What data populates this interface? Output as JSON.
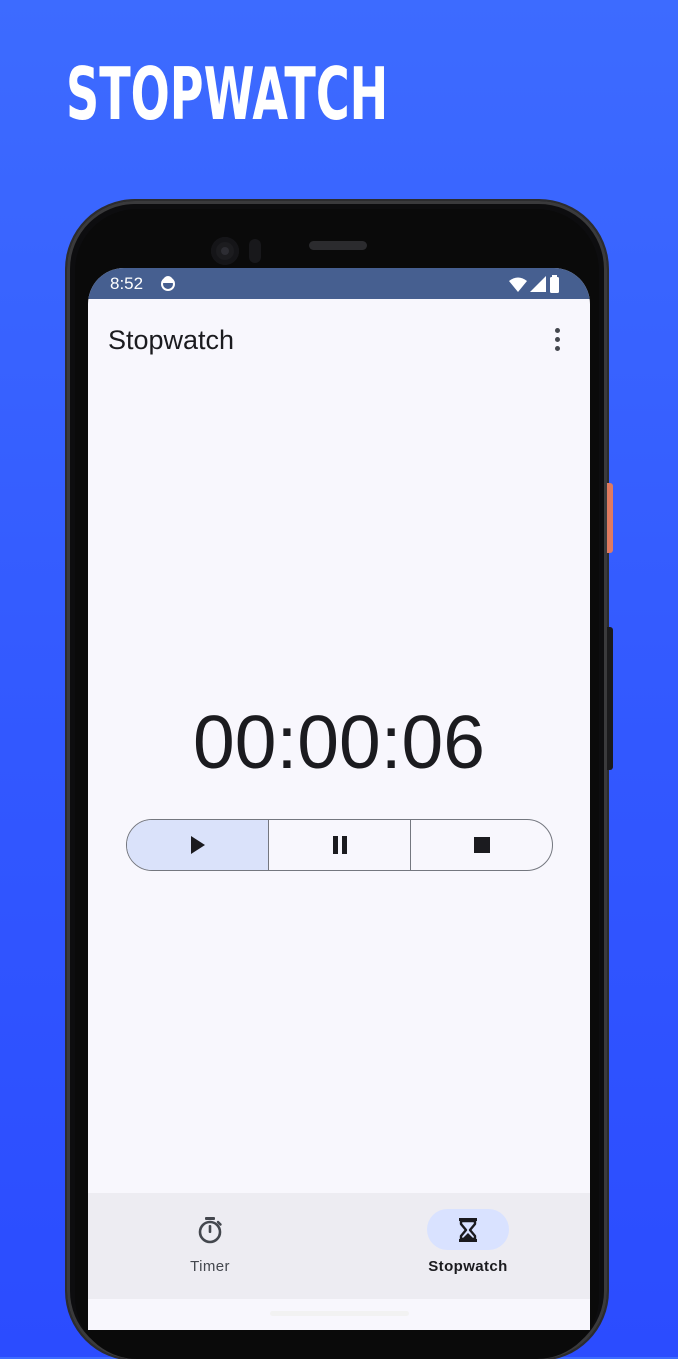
{
  "promo": {
    "title": "STOPWATCH"
  },
  "status_bar": {
    "time": "8:52",
    "icons": [
      "sync-icon",
      "wifi-icon",
      "cellular-signal-icon",
      "battery-icon"
    ]
  },
  "app_bar": {
    "title": "Stopwatch",
    "overflow_icon": "more-vert-icon"
  },
  "stopwatch": {
    "elapsed": "00:00:06"
  },
  "controls": [
    {
      "name": "start",
      "icon": "play-icon",
      "selected": true
    },
    {
      "name": "pause",
      "icon": "pause-icon",
      "selected": false
    },
    {
      "name": "stop",
      "icon": "stop-icon",
      "selected": false
    }
  ],
  "bottom_nav": {
    "items": [
      {
        "label": "Timer",
        "icon": "timer-icon",
        "selected": false
      },
      {
        "label": "Stopwatch",
        "icon": "hourglass-icon",
        "selected": true
      }
    ]
  },
  "colors": {
    "background_top": "#3d6bff",
    "background_bottom": "#2b4cff",
    "status_bar": "#465f90",
    "screen_bg": "#f8f7fd",
    "selected_segment": "#dae2fa",
    "nav_bg": "#edecf2",
    "nav_indicator": "#d9e2ff",
    "power_button": "#e07a5f"
  }
}
